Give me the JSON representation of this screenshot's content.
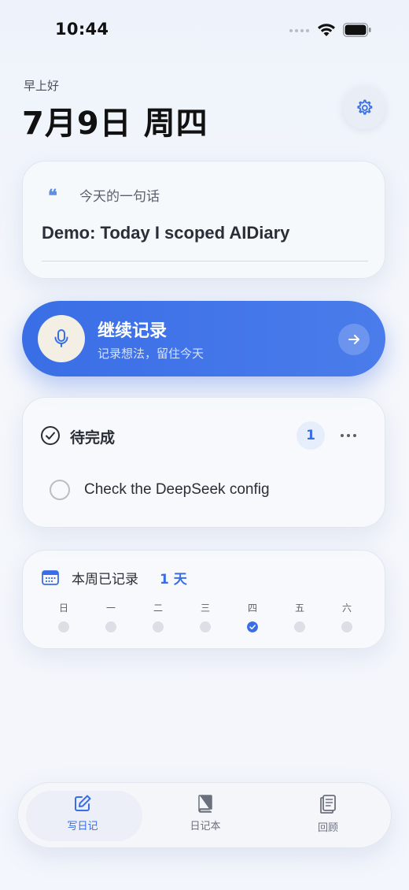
{
  "status_bar": {
    "time": "10:44"
  },
  "header": {
    "greeting": "早上好",
    "date": "7月9日 周四"
  },
  "quote_card": {
    "label": "今天的一句话",
    "quote_mark": "❝",
    "text": "Demo: Today I scoped AIDiary"
  },
  "record_button": {
    "title": "继续记录",
    "subtitle": "记录想法，留住今天"
  },
  "todo": {
    "title": "待完成",
    "count": "1",
    "items": [
      {
        "text": "Check the DeepSeek config",
        "done": false
      }
    ]
  },
  "week": {
    "label": "本周已记录",
    "count": "1 天",
    "days": [
      {
        "name": "日",
        "recorded": false
      },
      {
        "name": "一",
        "recorded": false
      },
      {
        "name": "二",
        "recorded": false
      },
      {
        "name": "三",
        "recorded": false
      },
      {
        "name": "四",
        "recorded": true
      },
      {
        "name": "五",
        "recorded": false
      },
      {
        "name": "六",
        "recorded": false
      }
    ]
  },
  "tabs": [
    {
      "label": "写日记",
      "icon": "edit-icon",
      "active": true
    },
    {
      "label": "日记本",
      "icon": "book-icon",
      "active": false
    },
    {
      "label": "回顾",
      "icon": "review-icon",
      "active": false
    }
  ],
  "colors": {
    "accent": "#3a6ee6",
    "tab_active": "#3a6ee6",
    "tab_inactive": "#6a707c"
  }
}
